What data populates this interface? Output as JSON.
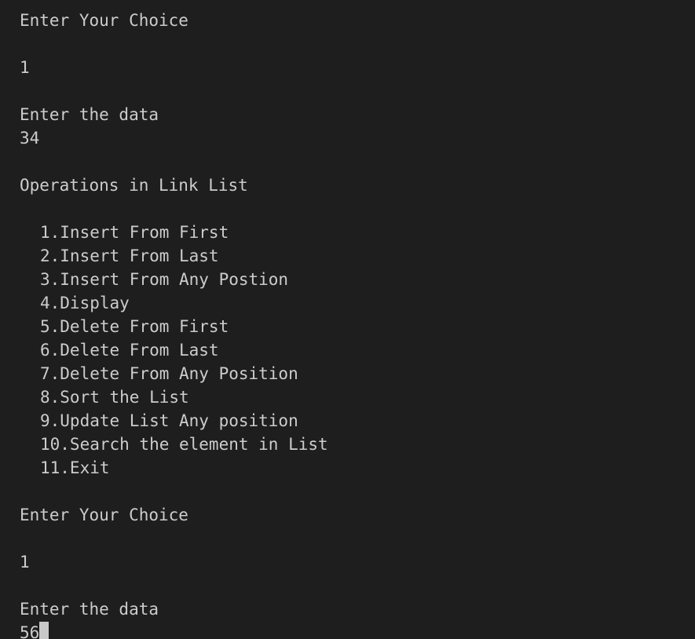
{
  "terminal": {
    "prompt_choice_1": "Enter Your Choice",
    "input_choice_1": "1",
    "prompt_data_1": "Enter the data",
    "input_data_1": "34",
    "menu_title": "Operations in Link List",
    "menu_items": [
      "1.Insert From First",
      "2.Insert From Last",
      "3.Insert From Any Postion",
      "4.Display",
      "5.Delete From First",
      "6.Delete From Last",
      "7.Delete From Any Position",
      "8.Sort the List",
      "9.Update List Any position",
      "10.Search the element in List",
      "11.Exit"
    ],
    "prompt_choice_2": "Enter Your Choice",
    "input_choice_2": "1",
    "prompt_data_2": "Enter the data",
    "input_data_2": "56"
  }
}
